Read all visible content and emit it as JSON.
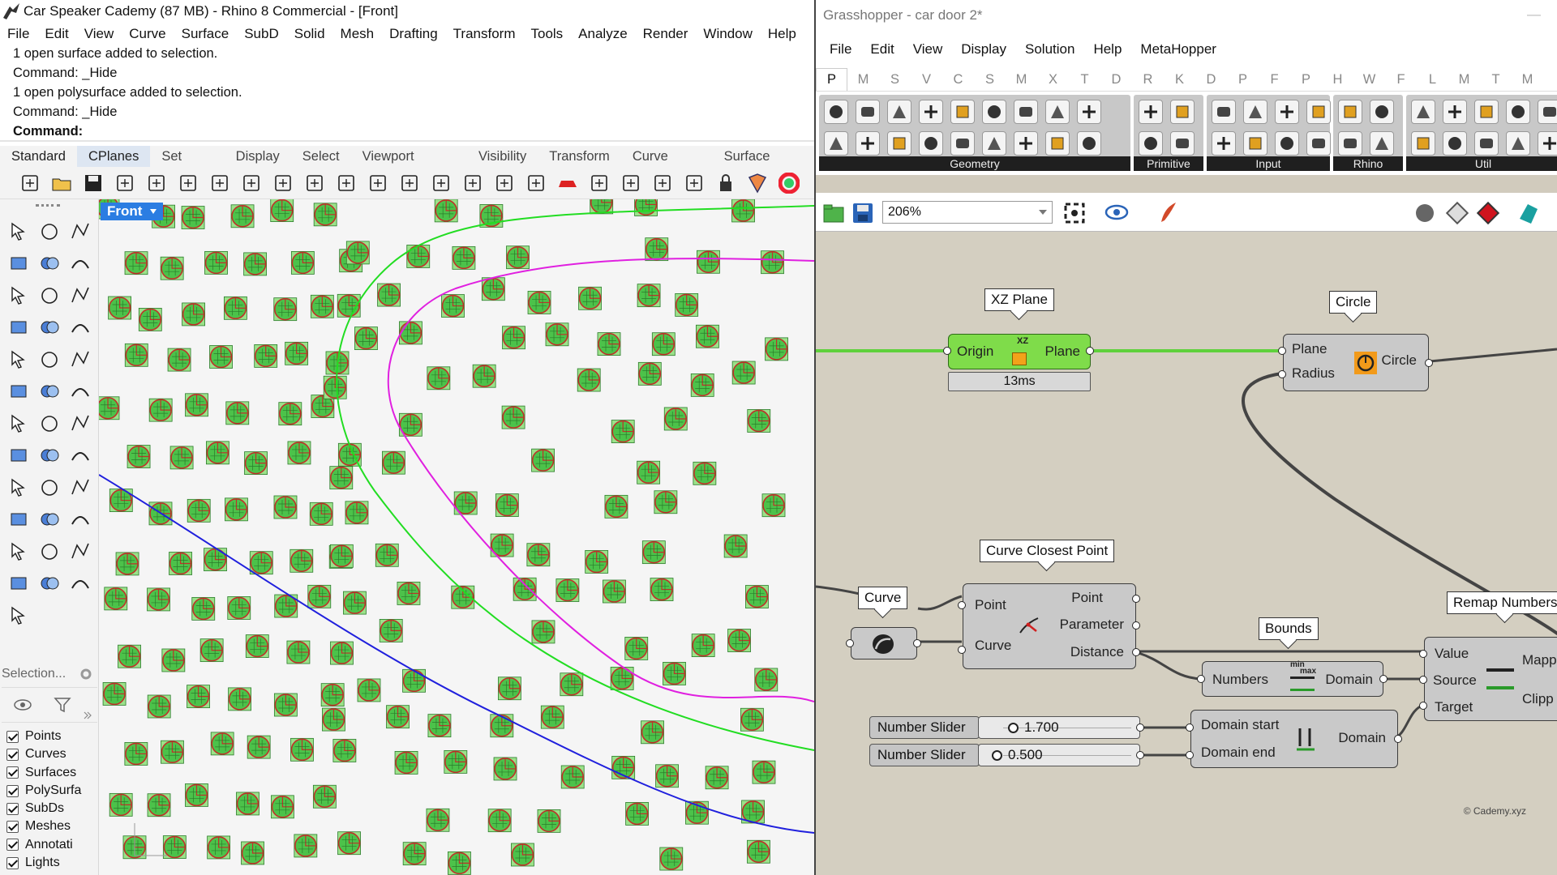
{
  "rhino": {
    "title": "Car Speaker Cademy (87 MB) - Rhino 8 Commercial - [Front]",
    "menu": [
      "File",
      "Edit",
      "View",
      "Curve",
      "Surface",
      "SubD",
      "Solid",
      "Mesh",
      "Drafting",
      "Transform",
      "Tools",
      "Analyze",
      "Render",
      "Window",
      "Help"
    ],
    "history": [
      "1 open surface added to selection.",
      "Command: _Hide",
      "1 open polysurface added to selection.",
      "Command: _Hide"
    ],
    "command_prompt": "Command:",
    "tabs": [
      "Standard",
      "CPlanes",
      "Set View",
      "Display",
      "Select",
      "Viewport Layout",
      "Visibility",
      "Transform",
      "Curve Tools",
      "Surface Tools"
    ],
    "viewport_label": "Front",
    "selection_label": "Selection...",
    "layers": [
      "Points",
      "Curves",
      "Surfaces",
      "PolySurfa",
      "SubDs",
      "Meshes",
      "Annotati",
      "Lights"
    ],
    "colors": {
      "disk_fill": "#4cc24a",
      "disk_border": "#c0302a",
      "curve_green": "#22dd22",
      "curve_magenta": "#e020e0",
      "curve_blue": "#2020dd",
      "viewport_tab": "#2b7de2"
    }
  },
  "gh": {
    "title": "Grasshopper - car door 2*",
    "menu": [
      "File",
      "Edit",
      "View",
      "Display",
      "Solution",
      "Help",
      "MetaHopper"
    ],
    "categories": [
      "P",
      "M",
      "S",
      "V",
      "C",
      "S",
      "M",
      "X",
      "T",
      "D",
      "R",
      "K",
      "D",
      "P",
      "F",
      "P",
      "H",
      "W",
      "F",
      "L",
      "M",
      "T",
      "M"
    ],
    "ribbon_groups": [
      "Geometry",
      "Primitive",
      "Input",
      "Rhino",
      "Util"
    ],
    "zoom": "206%",
    "components": {
      "xz_plane": {
        "bubble": "XZ Plane",
        "input": "Origin",
        "output": "Plane",
        "icon_text": "XZ",
        "timing": "13ms"
      },
      "circle": {
        "bubble": "Circle",
        "inputs": [
          "Plane",
          "Radius"
        ],
        "output": "Circle"
      },
      "curve": {
        "bubble": "Curve"
      },
      "ccp": {
        "bubble": "Curve Closest Point",
        "inputs": [
          "Point",
          "Curve"
        ],
        "outputs": [
          "Point",
          "Parameter",
          "Distance"
        ]
      },
      "bounds": {
        "bubble": "Bounds",
        "input": "Numbers",
        "output": "Domain",
        "icon_top": "min",
        "icon_bottom": "max"
      },
      "remap": {
        "bubble": "Remap Numbers",
        "inputs": [
          "Value",
          "Source",
          "Target"
        ],
        "outputs": [
          "Mapp",
          "Clipp"
        ]
      },
      "slider1": {
        "name": "Number Slider",
        "value": "1.700"
      },
      "slider2": {
        "name": "Number Slider",
        "value": "0.500"
      },
      "domain": {
        "inputs": [
          "Domain start",
          "Domain end"
        ],
        "output": "Domain"
      }
    },
    "copyright": "© Cademy.xyz",
    "colors": {
      "canvas": "#d4cfc1",
      "component": "#c9c9c9",
      "component_active": "#7fdc4a",
      "wire_green": "#5fd13c",
      "wire_dark": "#4a4a4a"
    }
  }
}
